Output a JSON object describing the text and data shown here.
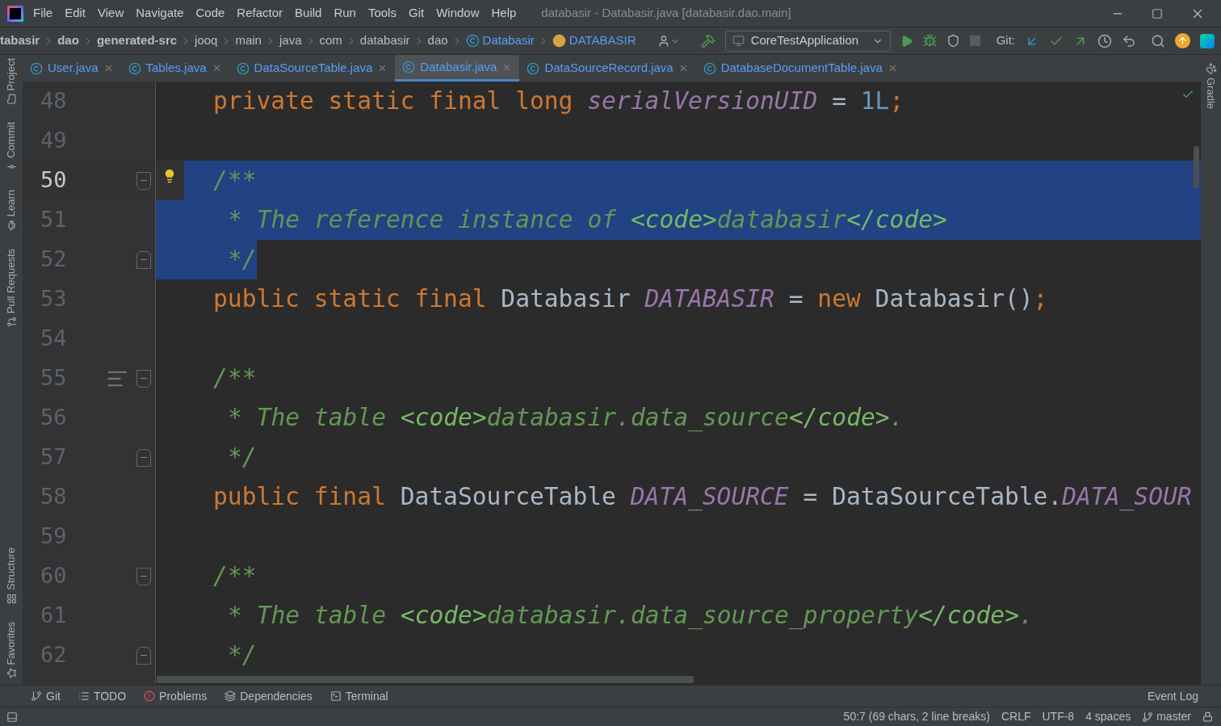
{
  "window": {
    "title": "databasir - Databasir.java [databasir.dao.main]"
  },
  "menu": [
    "File",
    "Edit",
    "View",
    "Navigate",
    "Code",
    "Refactor",
    "Build",
    "Run",
    "Tools",
    "Git",
    "Window",
    "Help"
  ],
  "breadcrumbs": [
    {
      "label": "tabasir",
      "kind": "module"
    },
    {
      "label": "dao",
      "kind": "module"
    },
    {
      "label": "generated-src",
      "kind": "module"
    },
    {
      "label": "jooq",
      "kind": "folder"
    },
    {
      "label": "main",
      "kind": "folder"
    },
    {
      "label": "java",
      "kind": "folder"
    },
    {
      "label": "com",
      "kind": "folder"
    },
    {
      "label": "databasir",
      "kind": "folder"
    },
    {
      "label": "dao",
      "kind": "folder"
    },
    {
      "label": "Databasir",
      "kind": "class"
    },
    {
      "label": "DATABASIR",
      "kind": "field"
    }
  ],
  "run_config": "CoreTestApplication",
  "git_label": "Git:",
  "tabs": [
    {
      "label": "User.java",
      "selected": false
    },
    {
      "label": "Tables.java",
      "selected": false
    },
    {
      "label": "DataSourceTable.java",
      "selected": false
    },
    {
      "label": "Databasir.java",
      "selected": true
    },
    {
      "label": "DataSourceRecord.java",
      "selected": false
    },
    {
      "label": "DatabaseDocumentTable.java",
      "selected": false
    }
  ],
  "left_tools_top": [
    {
      "label": "Project",
      "kind": "folder"
    },
    {
      "label": "Commit",
      "kind": "commit"
    },
    {
      "label": "Learn",
      "kind": "learn"
    },
    {
      "label": "Pull Requests",
      "kind": "pr"
    }
  ],
  "left_tools_bottom": [
    {
      "label": "Structure",
      "kind": "structure"
    },
    {
      "label": "Favorites",
      "kind": "star"
    }
  ],
  "right_tools": [
    {
      "label": "Gradle"
    }
  ],
  "lines": [
    {
      "number": "48",
      "current": false,
      "kind": "member",
      "selected": false,
      "tokens": [
        {
          "text": "private static final long ",
          "kind": "kw"
        },
        {
          "text": "serialVersionUID",
          "kind": "field"
        },
        {
          "text": " = ",
          "kind": "plain"
        },
        {
          "text": "1L",
          "kind": "num"
        },
        {
          "text": ";",
          "kind": "kw"
        }
      ]
    },
    {
      "number": "49",
      "current": false,
      "kind": "blank",
      "selected": false
    },
    {
      "number": "50",
      "current": true,
      "kind": "member",
      "selected": true,
      "selected_from_start": false,
      "selected_to_end": true,
      "fold": {
        "kind": "start"
      },
      "marker": {
        "kind": "bulb"
      },
      "tokens": [
        {
          "text": "/**",
          "kind": "doc"
        }
      ]
    },
    {
      "number": "51",
      "current": false,
      "kind": "doc",
      "selected": true,
      "selected_from_start": true,
      "selected_to_end": true,
      "tokens": [
        {
          "text": "* The reference instance of ",
          "kind": "doc"
        },
        {
          "text": "<code>",
          "kind": "tag"
        },
        {
          "text": "databasir",
          "kind": "doc"
        },
        {
          "text": "</code>",
          "kind": "tag"
        }
      ]
    },
    {
      "number": "52",
      "current": false,
      "kind": "doc",
      "selected": true,
      "selected_from_start": true,
      "selected_to_end": false,
      "fold": {
        "kind": "end"
      },
      "tokens": [
        {
          "text": "*/",
          "kind": "doc"
        }
      ]
    },
    {
      "number": "53",
      "current": false,
      "kind": "member",
      "selected": false,
      "tokens": [
        {
          "text": "public static final ",
          "kind": "kw"
        },
        {
          "text": "Databasir ",
          "kind": "plain"
        },
        {
          "text": "DATABASIR",
          "kind": "field"
        },
        {
          "text": " = ",
          "kind": "plain"
        },
        {
          "text": "new ",
          "kind": "kw"
        },
        {
          "text": "Databasir()",
          "kind": "plain"
        },
        {
          "text": ";",
          "kind": "kw"
        }
      ]
    },
    {
      "number": "54",
      "current": false,
      "kind": "blank",
      "selected": false
    },
    {
      "number": "55",
      "current": false,
      "kind": "member",
      "selected": false,
      "fold": {
        "kind": "start"
      },
      "marker": {
        "kind": "render"
      },
      "tokens": [
        {
          "text": "/**",
          "kind": "doc"
        }
      ]
    },
    {
      "number": "56",
      "current": false,
      "kind": "doc",
      "selected": false,
      "tokens": [
        {
          "text": "* The table ",
          "kind": "doc"
        },
        {
          "text": "<code>",
          "kind": "tag"
        },
        {
          "text": "databasir.data_source",
          "kind": "doc"
        },
        {
          "text": "</code>",
          "kind": "tag"
        },
        {
          "text": ".",
          "kind": "doc"
        }
      ]
    },
    {
      "number": "57",
      "current": false,
      "kind": "doc",
      "selected": false,
      "fold": {
        "kind": "end"
      },
      "tokens": [
        {
          "text": "*/",
          "kind": "doc"
        }
      ]
    },
    {
      "number": "58",
      "current": false,
      "kind": "member",
      "selected": false,
      "tokens": [
        {
          "text": "public final ",
          "kind": "kw"
        },
        {
          "text": "DataSourceTable ",
          "kind": "plain"
        },
        {
          "text": "DATA_SOURCE",
          "kind": "field"
        },
        {
          "text": " = DataSourceTable.",
          "kind": "plain"
        },
        {
          "text": "DATA_SOUR",
          "kind": "field"
        }
      ]
    },
    {
      "number": "59",
      "current": false,
      "kind": "blank",
      "selected": false
    },
    {
      "number": "60",
      "current": false,
      "kind": "member",
      "selected": false,
      "fold": {
        "kind": "start"
      },
      "tokens": [
        {
          "text": "/**",
          "kind": "doc"
        }
      ]
    },
    {
      "number": "61",
      "current": false,
      "kind": "doc",
      "selected": false,
      "tokens": [
        {
          "text": "* The table ",
          "kind": "doc"
        },
        {
          "text": "<code>",
          "kind": "tag"
        },
        {
          "text": "databasir.data_source_property",
          "kind": "doc"
        },
        {
          "text": "</code>",
          "kind": "tag"
        },
        {
          "text": ".",
          "kind": "doc"
        }
      ]
    },
    {
      "number": "62",
      "current": false,
      "kind": "doc",
      "selected": false,
      "fold": {
        "kind": "end"
      },
      "tokens": [
        {
          "text": "*/",
          "kind": "doc"
        }
      ]
    }
  ],
  "bottom_tools": [
    {
      "label": "Git",
      "kind": "branch"
    },
    {
      "label": "TODO",
      "kind": "list"
    },
    {
      "label": "Problems",
      "kind": "error"
    },
    {
      "label": "Dependencies",
      "kind": "layers"
    },
    {
      "label": "Terminal",
      "kind": "terminal"
    }
  ],
  "event_log": "Event Log",
  "status_bar": {
    "position": "50:7 (69 chars, 2 line breaks)",
    "line_separator": "CRLF",
    "encoding": "UTF-8",
    "indent": "4 spaces",
    "branch": "master"
  }
}
